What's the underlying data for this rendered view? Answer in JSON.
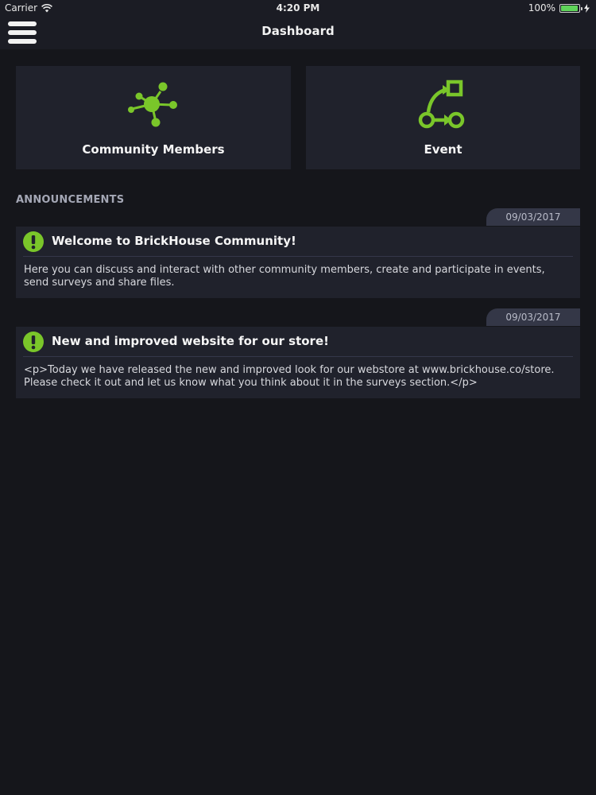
{
  "status_bar": {
    "carrier": "Carrier",
    "time": "4:20 PM",
    "battery": "100%",
    "battery_level": 1.0
  },
  "nav": {
    "title": "Dashboard",
    "menu_icon": "hamburger-menu-icon"
  },
  "tiles": [
    {
      "label": "Community Members",
      "icon": "network-nodes-icon"
    },
    {
      "label": "Event",
      "icon": "workflow-icon"
    }
  ],
  "announcements": {
    "section_title": "ANNOUNCEMENTS",
    "items": [
      {
        "date": "09/03/2017",
        "title": "Welcome to BrickHouse Community!",
        "body": "Here you can discuss and interact with other community members, create and participate in events, send surveys and share files."
      },
      {
        "date": "09/03/2017",
        "title": "New and improved website for our store!",
        "body": "<p>Today we have released the new and improved look for our webstore at www.brickhouse.co/store. Please check it out and let us know what you think about it in the surveys section.</p>"
      }
    ]
  },
  "colors": {
    "accent": "#7ac62a",
    "background": "#15161b",
    "card": "#20222c",
    "date_tab": "#343747"
  }
}
